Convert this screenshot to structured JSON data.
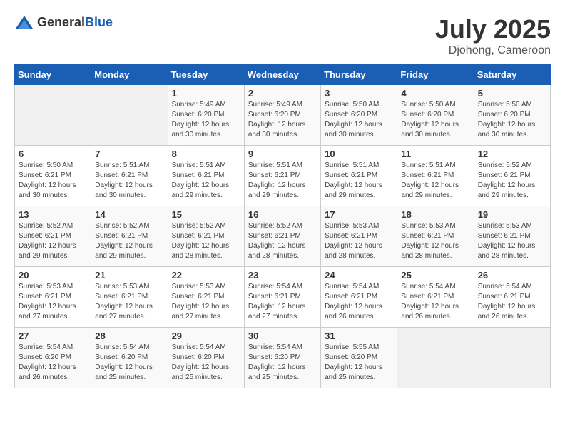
{
  "header": {
    "logo_general": "General",
    "logo_blue": "Blue",
    "month": "July 2025",
    "location": "Djohong, Cameroon"
  },
  "days_of_week": [
    "Sunday",
    "Monday",
    "Tuesday",
    "Wednesday",
    "Thursday",
    "Friday",
    "Saturday"
  ],
  "weeks": [
    [
      {
        "day": "",
        "empty": true
      },
      {
        "day": "",
        "empty": true
      },
      {
        "day": "1",
        "sunrise": "Sunrise: 5:49 AM",
        "sunset": "Sunset: 6:20 PM",
        "daylight": "Daylight: 12 hours and 30 minutes."
      },
      {
        "day": "2",
        "sunrise": "Sunrise: 5:49 AM",
        "sunset": "Sunset: 6:20 PM",
        "daylight": "Daylight: 12 hours and 30 minutes."
      },
      {
        "day": "3",
        "sunrise": "Sunrise: 5:50 AM",
        "sunset": "Sunset: 6:20 PM",
        "daylight": "Daylight: 12 hours and 30 minutes."
      },
      {
        "day": "4",
        "sunrise": "Sunrise: 5:50 AM",
        "sunset": "Sunset: 6:20 PM",
        "daylight": "Daylight: 12 hours and 30 minutes."
      },
      {
        "day": "5",
        "sunrise": "Sunrise: 5:50 AM",
        "sunset": "Sunset: 6:20 PM",
        "daylight": "Daylight: 12 hours and 30 minutes."
      }
    ],
    [
      {
        "day": "6",
        "sunrise": "Sunrise: 5:50 AM",
        "sunset": "Sunset: 6:21 PM",
        "daylight": "Daylight: 12 hours and 30 minutes."
      },
      {
        "day": "7",
        "sunrise": "Sunrise: 5:51 AM",
        "sunset": "Sunset: 6:21 PM",
        "daylight": "Daylight: 12 hours and 30 minutes."
      },
      {
        "day": "8",
        "sunrise": "Sunrise: 5:51 AM",
        "sunset": "Sunset: 6:21 PM",
        "daylight": "Daylight: 12 hours and 29 minutes."
      },
      {
        "day": "9",
        "sunrise": "Sunrise: 5:51 AM",
        "sunset": "Sunset: 6:21 PM",
        "daylight": "Daylight: 12 hours and 29 minutes."
      },
      {
        "day": "10",
        "sunrise": "Sunrise: 5:51 AM",
        "sunset": "Sunset: 6:21 PM",
        "daylight": "Daylight: 12 hours and 29 minutes."
      },
      {
        "day": "11",
        "sunrise": "Sunrise: 5:51 AM",
        "sunset": "Sunset: 6:21 PM",
        "daylight": "Daylight: 12 hours and 29 minutes."
      },
      {
        "day": "12",
        "sunrise": "Sunrise: 5:52 AM",
        "sunset": "Sunset: 6:21 PM",
        "daylight": "Daylight: 12 hours and 29 minutes."
      }
    ],
    [
      {
        "day": "13",
        "sunrise": "Sunrise: 5:52 AM",
        "sunset": "Sunset: 6:21 PM",
        "daylight": "Daylight: 12 hours and 29 minutes."
      },
      {
        "day": "14",
        "sunrise": "Sunrise: 5:52 AM",
        "sunset": "Sunset: 6:21 PM",
        "daylight": "Daylight: 12 hours and 29 minutes."
      },
      {
        "day": "15",
        "sunrise": "Sunrise: 5:52 AM",
        "sunset": "Sunset: 6:21 PM",
        "daylight": "Daylight: 12 hours and 28 minutes."
      },
      {
        "day": "16",
        "sunrise": "Sunrise: 5:52 AM",
        "sunset": "Sunset: 6:21 PM",
        "daylight": "Daylight: 12 hours and 28 minutes."
      },
      {
        "day": "17",
        "sunrise": "Sunrise: 5:53 AM",
        "sunset": "Sunset: 6:21 PM",
        "daylight": "Daylight: 12 hours and 28 minutes."
      },
      {
        "day": "18",
        "sunrise": "Sunrise: 5:53 AM",
        "sunset": "Sunset: 6:21 PM",
        "daylight": "Daylight: 12 hours and 28 minutes."
      },
      {
        "day": "19",
        "sunrise": "Sunrise: 5:53 AM",
        "sunset": "Sunset: 6:21 PM",
        "daylight": "Daylight: 12 hours and 28 minutes."
      }
    ],
    [
      {
        "day": "20",
        "sunrise": "Sunrise: 5:53 AM",
        "sunset": "Sunset: 6:21 PM",
        "daylight": "Daylight: 12 hours and 27 minutes."
      },
      {
        "day": "21",
        "sunrise": "Sunrise: 5:53 AM",
        "sunset": "Sunset: 6:21 PM",
        "daylight": "Daylight: 12 hours and 27 minutes."
      },
      {
        "day": "22",
        "sunrise": "Sunrise: 5:53 AM",
        "sunset": "Sunset: 6:21 PM",
        "daylight": "Daylight: 12 hours and 27 minutes."
      },
      {
        "day": "23",
        "sunrise": "Sunrise: 5:54 AM",
        "sunset": "Sunset: 6:21 PM",
        "daylight": "Daylight: 12 hours and 27 minutes."
      },
      {
        "day": "24",
        "sunrise": "Sunrise: 5:54 AM",
        "sunset": "Sunset: 6:21 PM",
        "daylight": "Daylight: 12 hours and 26 minutes."
      },
      {
        "day": "25",
        "sunrise": "Sunrise: 5:54 AM",
        "sunset": "Sunset: 6:21 PM",
        "daylight": "Daylight: 12 hours and 26 minutes."
      },
      {
        "day": "26",
        "sunrise": "Sunrise: 5:54 AM",
        "sunset": "Sunset: 6:21 PM",
        "daylight": "Daylight: 12 hours and 26 minutes."
      }
    ],
    [
      {
        "day": "27",
        "sunrise": "Sunrise: 5:54 AM",
        "sunset": "Sunset: 6:20 PM",
        "daylight": "Daylight: 12 hours and 26 minutes."
      },
      {
        "day": "28",
        "sunrise": "Sunrise: 5:54 AM",
        "sunset": "Sunset: 6:20 PM",
        "daylight": "Daylight: 12 hours and 25 minutes."
      },
      {
        "day": "29",
        "sunrise": "Sunrise: 5:54 AM",
        "sunset": "Sunset: 6:20 PM",
        "daylight": "Daylight: 12 hours and 25 minutes."
      },
      {
        "day": "30",
        "sunrise": "Sunrise: 5:54 AM",
        "sunset": "Sunset: 6:20 PM",
        "daylight": "Daylight: 12 hours and 25 minutes."
      },
      {
        "day": "31",
        "sunrise": "Sunrise: 5:55 AM",
        "sunset": "Sunset: 6:20 PM",
        "daylight": "Daylight: 12 hours and 25 minutes."
      },
      {
        "day": "",
        "empty": true
      },
      {
        "day": "",
        "empty": true
      }
    ]
  ]
}
